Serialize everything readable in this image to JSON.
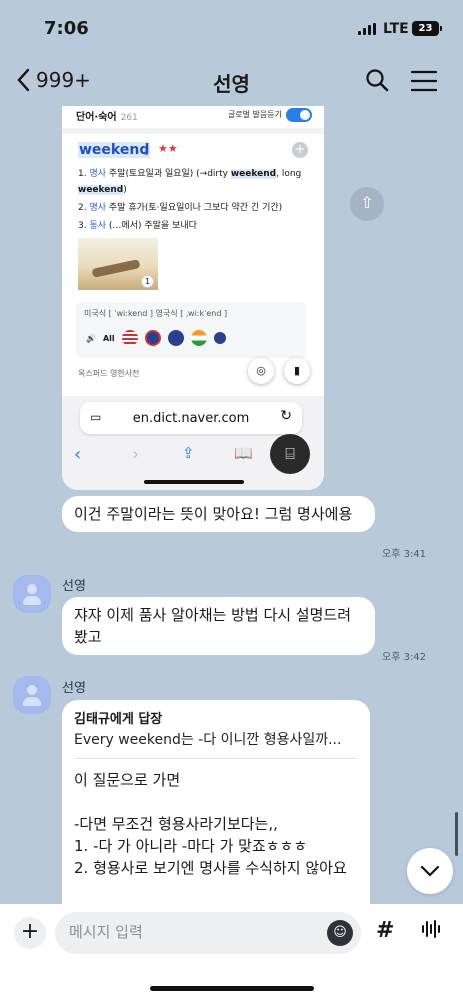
{
  "status_bar": {
    "time": "7:06",
    "network": "LTE",
    "battery": "23"
  },
  "header": {
    "back_label": "999+",
    "title": "선영"
  },
  "shared_image": {
    "dict": {
      "section": "단어·숙어",
      "section_count": "261",
      "global_toggle_label": "글로벌 발음듣기",
      "headword": "weekend",
      "stars": "★★",
      "definitions": [
        {
          "n": "1.",
          "pos": "명사",
          "pre": "주말(토요일과 일요일) (→dirty ",
          "hl": "weekend",
          "post": ", long ",
          "hl2": "weekend",
          "end": ")"
        },
        {
          "n": "2.",
          "pos": "명사",
          "text": "주말 휴가(토·일요일이나 그보다 약간 긴 기간)"
        },
        {
          "n": "3.",
          "pos": "동사",
          "text": "(…에서) 주말을 보내다"
        }
      ],
      "image_number": "1",
      "pronunciation": "미국식 [ ˈwiːkend ]   영국식 [ ˌwiːkˈend ]",
      "play_all": "All",
      "source": "옥스퍼드 영한사전"
    },
    "browser": {
      "url": "en.dict.naver.com"
    }
  },
  "messages": [
    {
      "type": "out",
      "text": "이건 주말이라는 뜻이 맞아요! 그럼 명사에용",
      "time": "오후 3:41"
    },
    {
      "type": "in",
      "sender": "선영",
      "text": "쟈쟈 이제 품사 알아채는 방법 다시 설명드려 봤고",
      "time": "오후 3:42"
    },
    {
      "type": "in",
      "sender": "선영",
      "reply_to": "김태규에게 답장",
      "quote": "Every weekend는 -다 이니깐 형용사일까...",
      "lines": [
        "이 질문으로 가면",
        "",
        "-다면 무조건 형용사라기보다는,,",
        "1. -다 가 아니라 -마다 가 맞죠ㅎㅎㅎ",
        "2. 형용사로 보기엔 명사를 수식하지 않아요"
      ]
    }
  ],
  "input": {
    "placeholder": "메시지 입력",
    "hash": "#"
  },
  "colors": {
    "background": "#b8c9da",
    "bubble": "#ffffff",
    "avatar": "#a6b9ef",
    "link_blue": "#1f50b9"
  }
}
